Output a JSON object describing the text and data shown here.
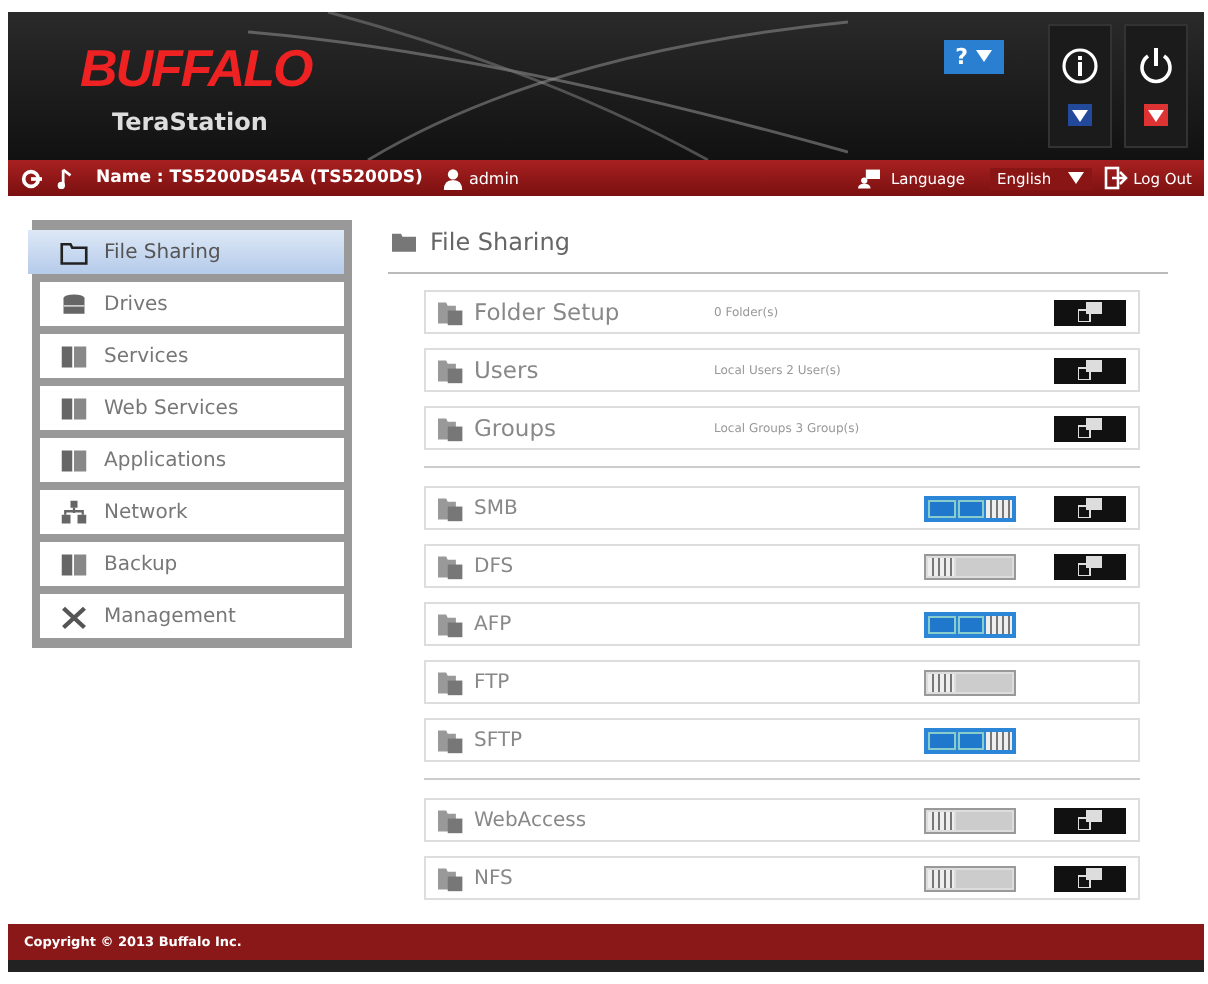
{
  "header": {
    "logo": "BUFFALO",
    "product": "TeraStation",
    "help_button": "?"
  },
  "toolbar": {
    "name": "Name : TS5200DS45A (TS5200DS)",
    "user": "admin",
    "language_label": "Language",
    "language": "English",
    "logout": "Log Out"
  },
  "sidebar": {
    "items": [
      {
        "label": "File Sharing",
        "selected": true
      },
      {
        "label": "Drives",
        "selected": false
      },
      {
        "label": "Services",
        "selected": false
      },
      {
        "label": "Web Services",
        "selected": false
      },
      {
        "label": "Applications",
        "selected": false
      },
      {
        "label": "Network",
        "selected": false
      },
      {
        "label": "Backup",
        "selected": false
      },
      {
        "label": "Management",
        "selected": false
      }
    ]
  },
  "main": {
    "title": "File Sharing",
    "sections": [
      {
        "rows": [
          {
            "kind": "summary",
            "label": "Folder Setup",
            "info": "0 Folder(s)",
            "settings": true
          },
          {
            "kind": "summary",
            "label": "Users",
            "info": "Local Users 2 User(s)",
            "settings": true
          },
          {
            "kind": "summary",
            "label": "Groups",
            "info": "Local Groups 3 Group(s)",
            "settings": true
          }
        ]
      },
      {
        "rows": [
          {
            "kind": "service",
            "label": "SMB",
            "on": true,
            "settings": true
          },
          {
            "kind": "service",
            "label": "DFS",
            "on": false,
            "settings": true
          },
          {
            "kind": "service",
            "label": "AFP",
            "on": true,
            "settings": false
          },
          {
            "kind": "service",
            "label": "FTP",
            "on": false,
            "settings": false
          },
          {
            "kind": "service",
            "label": "SFTP",
            "on": true,
            "settings": false
          }
        ]
      },
      {
        "rows": [
          {
            "kind": "service",
            "label": "WebAccess",
            "on": false,
            "settings": true
          },
          {
            "kind": "service",
            "label": "NFS",
            "on": false,
            "settings": true
          }
        ]
      }
    ]
  },
  "footer": "Copyright © 2013 Buffalo Inc."
}
